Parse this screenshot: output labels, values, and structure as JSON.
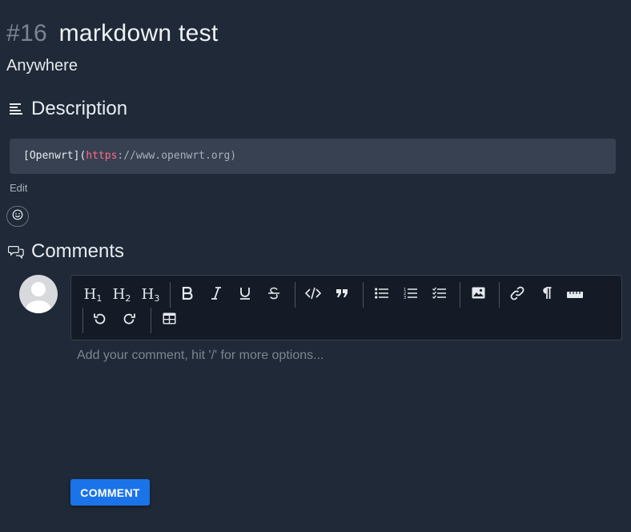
{
  "task": {
    "number": "#16",
    "title": "markdown test",
    "project": "Anywhere"
  },
  "description": {
    "heading": "Description",
    "code_prefix": "[Openwrt](",
    "code_protocol": "https",
    "code_rest": "://www.openwrt.org)",
    "edit_label": "Edit"
  },
  "comments": {
    "heading": "Comments",
    "placeholder": "Add your comment, hit '/' for more options...",
    "submit_label": "COMMENT"
  },
  "toolbar": {
    "h1_base": "H",
    "h1_sub": "1",
    "h2_base": "H",
    "h2_sub": "2",
    "h3_base": "H",
    "h3_sub": "3",
    "items": [
      "bold-icon",
      "italic-icon",
      "underline-icon",
      "strikethrough-icon",
      "code-icon",
      "quote-icon",
      "bullet-list-icon",
      "ordered-list-icon",
      "task-list-icon",
      "image-icon",
      "link-icon",
      "paragraph-icon",
      "horizontal-rule-icon",
      "undo-icon",
      "redo-icon",
      "table-icon"
    ]
  },
  "colors": {
    "background": "#1f2937",
    "code_bg": "#374151",
    "editor_bg": "#141b26",
    "accent": "#1a73e8",
    "url": "#ff6b8a"
  }
}
